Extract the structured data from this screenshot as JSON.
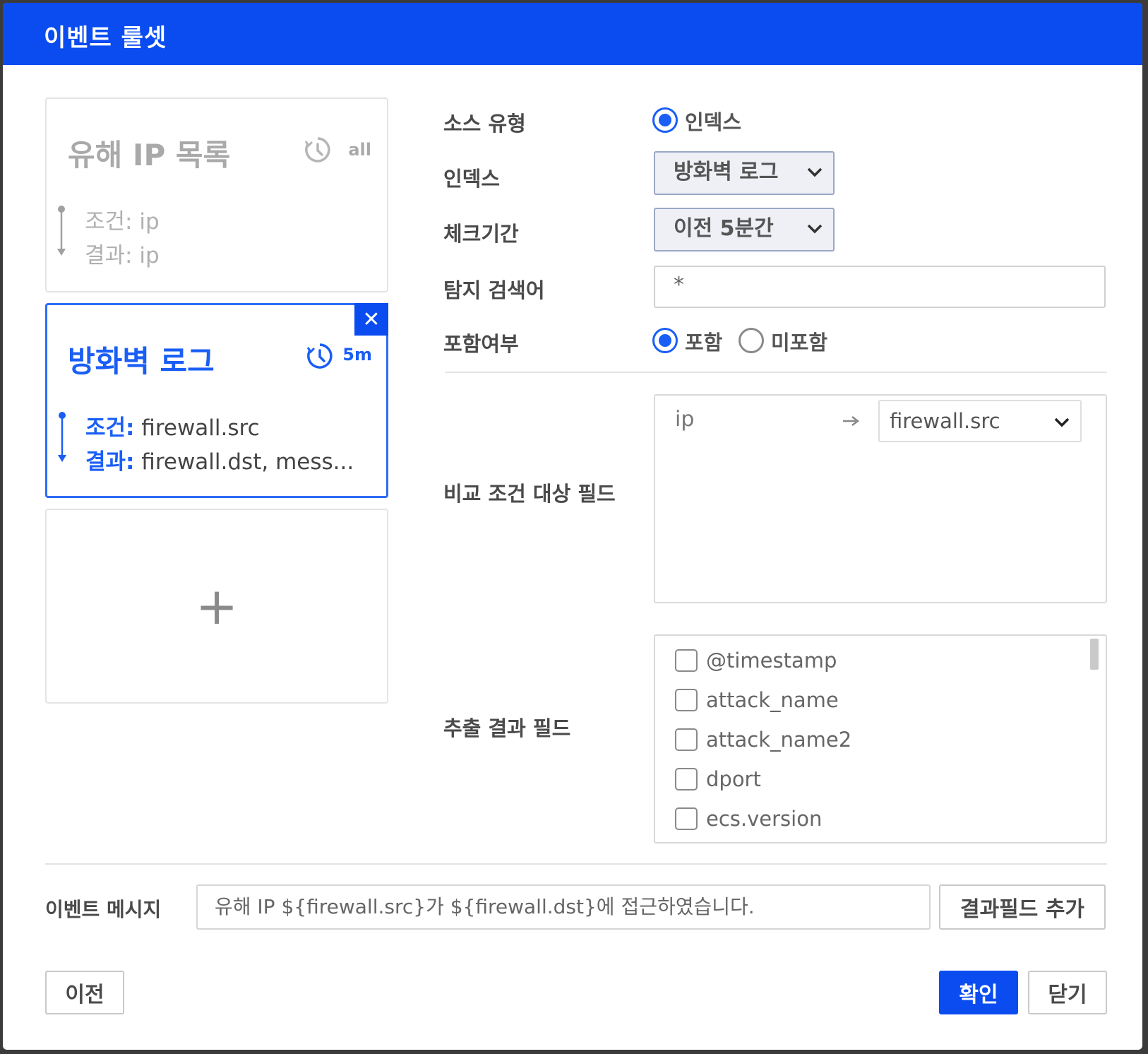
{
  "dialog": {
    "title": "이벤트 룰셋"
  },
  "cards": [
    {
      "title": "유해 IP 목록",
      "period": "all",
      "condition_label": "조건:",
      "condition_value": " ip",
      "result_label": "결과:",
      "result_value": " ip"
    },
    {
      "title": "방화벽 로그",
      "period": "5m",
      "condition_label": "조건:",
      "condition_value": " firewall.src",
      "result_label": "결과:",
      "result_value": " firewall.dst, mess..."
    }
  ],
  "add_card": {
    "symbol": "+"
  },
  "close_symbol": "✕",
  "form": {
    "source_type": {
      "label": "소스 유형",
      "option": "인덱스"
    },
    "index": {
      "label": "인덱스",
      "value": "방화벽 로그"
    },
    "check_period": {
      "label": "체크기간",
      "value": "이전 5분간"
    },
    "search": {
      "label": "탐지 검색어",
      "value": "*"
    },
    "include": {
      "label": "포함여부",
      "option_include": "포함",
      "option_exclude": "미포함"
    },
    "compare": {
      "label": "비교 조건 대상 필드",
      "from": "ip",
      "to": "firewall.src"
    },
    "extract": {
      "label": "추출 결과 필드",
      "fields": [
        "@timestamp",
        "attack_name",
        "attack_name2",
        "dport",
        "ecs.version"
      ]
    }
  },
  "message": {
    "label": "이벤트 메시지",
    "value": "유해 IP ${firewall.src}가 ${firewall.dst}에 접근하였습니다.",
    "add_field_button": "결과필드 추가"
  },
  "footer": {
    "prev_button": "이전",
    "ok_button": "확인",
    "close_button": "닫기"
  },
  "colors": {
    "accent": "#0a4cf0",
    "link": "#1a5ef5"
  }
}
